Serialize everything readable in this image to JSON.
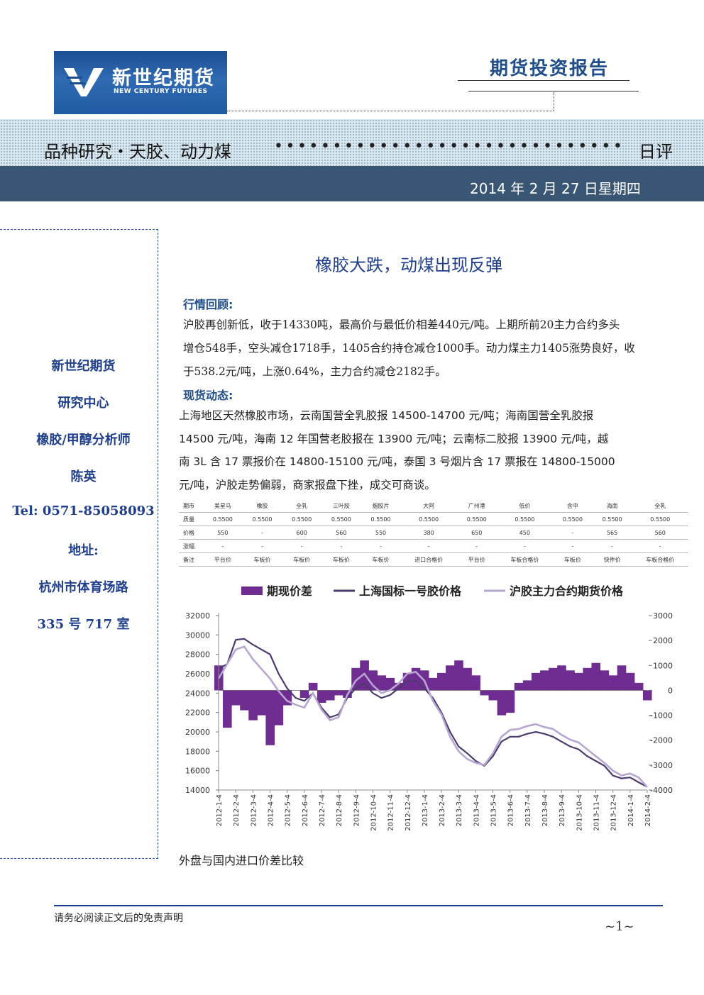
{
  "header": {
    "logo_cn": "新世纪期货",
    "logo_en": "NEW CENTURY FUTURES",
    "report_type": "期货投资报告"
  },
  "band": {
    "title": "品种研究・天胶、动力煤",
    "dots": "••••••••••••••••••••••••••••••",
    "right": "日评",
    "date": "2014 年 2 月 27 日星期四"
  },
  "sidebar": {
    "lines": [
      "新世纪期货",
      "研究中心",
      "橡胶/甲醇分析师",
      "陈英",
      "Tel: 0571-85058093",
      "地址:",
      "杭州市体育场路",
      "335 号 717 室"
    ]
  },
  "main": {
    "headline": "橡胶大跌，动煤出现反弹",
    "section1_title": "行情回顾:",
    "section1_lines": [
      "沪胶再创新低，收于14330吨，最高价与最低价相差440元/吨。上期所前20主力合约多头",
      "增仓548手，空头减仓1718手，1405合约持仓减仓1000手。动力煤主力1405涨势良好，收",
      "于538.2元/吨，上涨0.64%，主力合约减仓2182手。"
    ],
    "section2_title": "现货动态:",
    "section2_lines": [
      "上海地区天然橡胶市场，云南国营全乳胶报 14500-14700 元/吨；海南国营全乳胶报",
      "14500 元/吨，海南 12 年国营老胶报在 13900 元/吨；云南标二胶报 13900 元/吨，越",
      "南 3L 含 17 票报价在 14800-15100 元/吨，泰国 3 号烟片含 17 票报在 14800-15000",
      "元/吨，沪胶走势偏弱，商家报盘下挫，成交可商谈。"
    ],
    "caption": "外盘与国内进口价差比较"
  },
  "table": {
    "rows": [
      [
        "期市",
        "美星马",
        "橡胶",
        "全乳",
        "三叶胶",
        "烟胶片",
        "大阿",
        "广州港",
        "低价",
        "含中",
        "海南",
        "全乳"
      ],
      [
        "质量",
        "0.5500",
        "0.5500",
        "0.5500",
        "0.5500",
        "0.5500",
        "0.5500",
        "0.5500",
        "0.5500",
        "0.5500",
        "0.5500",
        "0.5500"
      ],
      [
        "价格",
        "550",
        "-",
        "600",
        "560",
        "550",
        "380",
        "650",
        "450",
        "-",
        "565",
        "560"
      ],
      [
        "涨幅",
        "-",
        "-",
        "-",
        "-",
        "-",
        "-",
        "-",
        "-",
        "-",
        "-",
        "-"
      ],
      [
        "备注",
        "平台价",
        "车板价",
        "车板价",
        "车板价",
        "车板价",
        "进口合格价",
        "平台价",
        "车板合格价",
        "车板价",
        "快件价",
        "车板合格价"
      ]
    ]
  },
  "chart_data": {
    "type": "line",
    "series": [
      {
        "name": "期现价差",
        "kind": "area-axis2",
        "color": "#6f2c91",
        "values": [
          1000,
          -1500,
          -600,
          -800,
          -1200,
          -1000,
          -2200,
          -1400,
          -600,
          0,
          -300,
          300,
          -500,
          -400,
          -200,
          -300,
          900,
          1200,
          800,
          600,
          500,
          300,
          700,
          900,
          800,
          500,
          700,
          1000,
          1200,
          900,
          600,
          -200,
          -400,
          -1000,
          -900,
          300,
          400,
          700,
          800,
          900,
          1000,
          800,
          700,
          900,
          1100,
          800,
          600,
          1000,
          700,
          300,
          -400
        ]
      },
      {
        "name": "上海国标一号胶价格",
        "kind": "line",
        "color": "#4d3a6e",
        "values": [
          26500,
          27000,
          29500,
          29600,
          29000,
          28500,
          28000,
          26000,
          24500,
          23500,
          23200,
          24000,
          22500,
          21500,
          21800,
          23500,
          24500,
          25000,
          24000,
          23500,
          23800,
          24500,
          25200,
          25300,
          24500,
          23500,
          22000,
          20000,
          18500,
          17800,
          17000,
          16500,
          17500,
          19000,
          19500,
          19500,
          19800,
          20000,
          19800,
          19500,
          19000,
          18500,
          18200,
          17500,
          17000,
          16500,
          15500,
          15200,
          15300,
          14800,
          14330
        ]
      },
      {
        "name": "沪胶主力合约期货价格",
        "kind": "line",
        "color": "#b7a6cf",
        "values": [
          25500,
          27000,
          28500,
          28800,
          27500,
          26500,
          25500,
          24200,
          23200,
          22800,
          22500,
          24000,
          22300,
          21200,
          21500,
          23800,
          25300,
          26000,
          24800,
          24000,
          24300,
          25000,
          26000,
          26200,
          25300,
          23200,
          21800,
          19500,
          18000,
          17200,
          16800,
          16600,
          17800,
          19500,
          20200,
          20300,
          20600,
          20800,
          20500,
          20300,
          19700,
          19200,
          18900,
          18200,
          17500,
          16800,
          16000,
          15500,
          15700,
          15300,
          14300
        ]
      }
    ],
    "x_labels": [
      "2012-1-4",
      "2012-2-4",
      "2012-3-4",
      "2012-4-4",
      "2012-5-4",
      "2012-6-4",
      "2012-7-4",
      "2012-8-4",
      "2012-9-4",
      "2012-10-4",
      "2012-11-4",
      "2012-12-4",
      "2013-1-4",
      "2013-2-4",
      "2013-3-4",
      "2013-4-4",
      "2013-5-4",
      "2013-6-4",
      "2013-7-4",
      "2013-8-4",
      "2013-9-4",
      "2013-10-4",
      "2013-11-4",
      "2013-12-4",
      "2014-1-4",
      "2014-2-4"
    ],
    "y_ticks": [
      "32000",
      "30000",
      "28000",
      "26000",
      "24000",
      "22000",
      "20000",
      "18000",
      "16000",
      "14000"
    ],
    "y2_ticks": [
      "3000",
      "2000",
      "1000",
      "0",
      "-1000",
      "-2000",
      "-3000",
      "-4000"
    ],
    "ylim": [
      14000,
      32000
    ],
    "y2lim": [
      -4000,
      3000
    ]
  },
  "footer": {
    "disclaimer": "请务必阅读正文后的免责声明",
    "page": "~1~"
  }
}
